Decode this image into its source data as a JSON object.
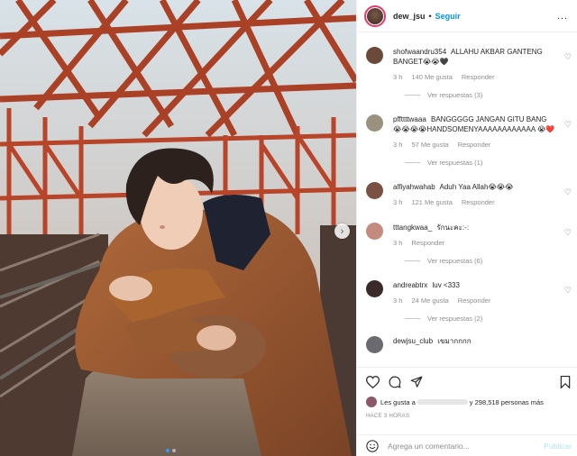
{
  "post": {
    "username": "dew_jsu",
    "separator": "•",
    "follow_label": "Seguir",
    "more_label": "..."
  },
  "photo": {
    "carousel_dots": 2,
    "active_dot": 0,
    "next_icon": "chevron-right-icon"
  },
  "comments": [
    {
      "user": "shofwaandru354",
      "text": "ALLAHU AKBAR GANTENG BANGET😭😭🖤",
      "time": "3 h",
      "likes": "140 Me gusta",
      "reply_label": "Responder",
      "view_replies": "Ver respuestas (3)",
      "avatar_color": "#6b4a3a"
    },
    {
      "user": "pffttttwaaa",
      "text": "BANGGGGG JANGAN GITU BANG 😭😭😭😭HANDSOMENYAAAAAAAAAAAA 😭❤️",
      "time": "3 h",
      "likes": "57 Me gusta",
      "reply_label": "Responder",
      "view_replies": "Ver respuestas (1)",
      "avatar_color": "#9a9180"
    },
    {
      "user": "alfiyahwahab",
      "text": "Aduh Yaa Allah😭😭😭",
      "time": "3 h",
      "likes": "121 Me gusta",
      "reply_label": "Responder",
      "view_replies": "",
      "avatar_color": "#7a5244"
    },
    {
      "user": "tttangkwaa_",
      "text": "รักนะคะ:-:",
      "time": "3 h",
      "likes": "",
      "reply_label": "Responder",
      "view_replies": "Ver respuestas (6)",
      "avatar_color": "#c48a80"
    },
    {
      "user": "andreabtrx",
      "text": "luv <333",
      "time": "3 h",
      "likes": "24 Me gusta",
      "reply_label": "Responder",
      "view_replies": "Ver respuestas (2)",
      "avatar_color": "#3b2a2a"
    },
    {
      "user": "dewjsu_club",
      "text": "เขมากกกก",
      "time": "",
      "likes": "",
      "reply_label": "",
      "view_replies": "",
      "avatar_color": "#6a6a70"
    }
  ],
  "actions": {
    "like_icon": "heart-icon",
    "comment_icon": "comment-icon",
    "share_icon": "share-icon",
    "save_icon": "bookmark-icon"
  },
  "likes": {
    "prefix": "Les gusta a",
    "suffix": "y 298,518 personas más"
  },
  "time_ago": "HACE 3 HORAS",
  "add_comment": {
    "placeholder": "Agrega un comentario...",
    "publish_label": "Publicar"
  },
  "colors": {
    "accent": "#0095f6",
    "muted": "#8e8e8e",
    "publish_disabled": "#b2dffc"
  }
}
